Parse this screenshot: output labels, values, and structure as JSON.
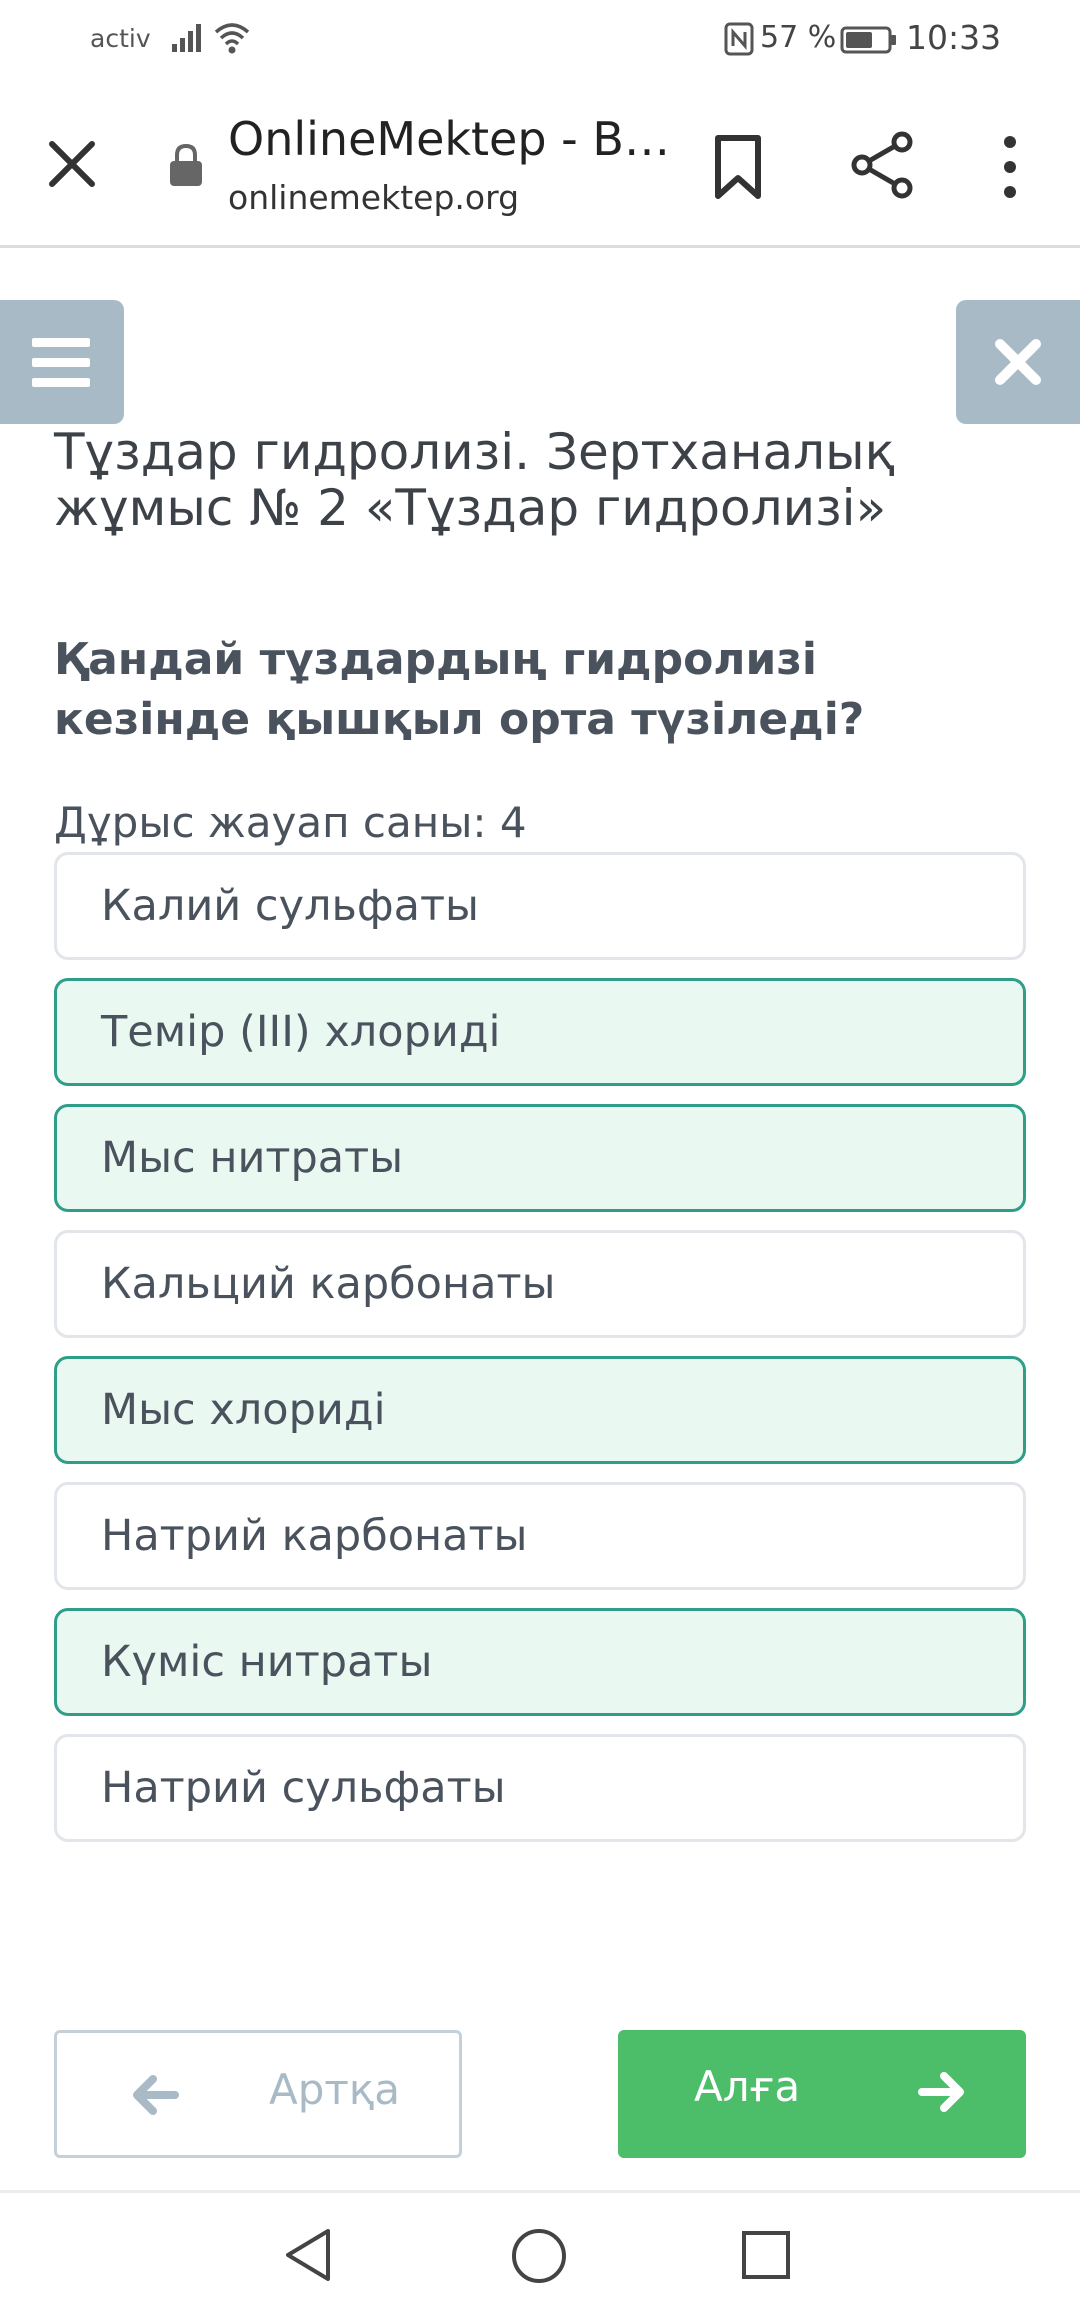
{
  "status_bar": {
    "carrier": "activ",
    "battery": "57 %",
    "time": "10:33",
    "icons": [
      "signal-icon",
      "wifi-icon",
      "nfc-icon",
      "battery-icon"
    ]
  },
  "browser": {
    "title": "OnlineMektep - B…",
    "url": "onlinemektep.org",
    "icons": [
      "close-icon",
      "lock-icon",
      "bookmark-icon",
      "share-icon",
      "more-vert-icon"
    ]
  },
  "page": {
    "title": "Тұздар гидролизі. Зертханалық жұмыс № 2 «Тұздар гидролизі»",
    "question": "Қандай тұздардың гидролизі кезінде қышқыл орта түзіледі?",
    "answer_count": "Дұрыс жауап саны: 4",
    "options": [
      {
        "label": "Калий сульфаты",
        "selected": false
      },
      {
        "label": "Темір (III) хлориді",
        "selected": true
      },
      {
        "label": "Мыс нитраты",
        "selected": true
      },
      {
        "label": "Кальций карбонаты",
        "selected": false
      },
      {
        "label": "Мыс хлориді",
        "selected": true
      },
      {
        "label": "Натрий карбонаты",
        "selected": false
      },
      {
        "label": "Күміс нитраты",
        "selected": true
      },
      {
        "label": "Натрий сульфаты",
        "selected": false
      }
    ],
    "back_label": "Артқа",
    "next_label": "Алға"
  },
  "colors": {
    "accent_green": "#4cbd68",
    "selected_border": "#2e9e89",
    "selected_fill": "#eaf8f2",
    "control_grey": "#a9bac7"
  }
}
